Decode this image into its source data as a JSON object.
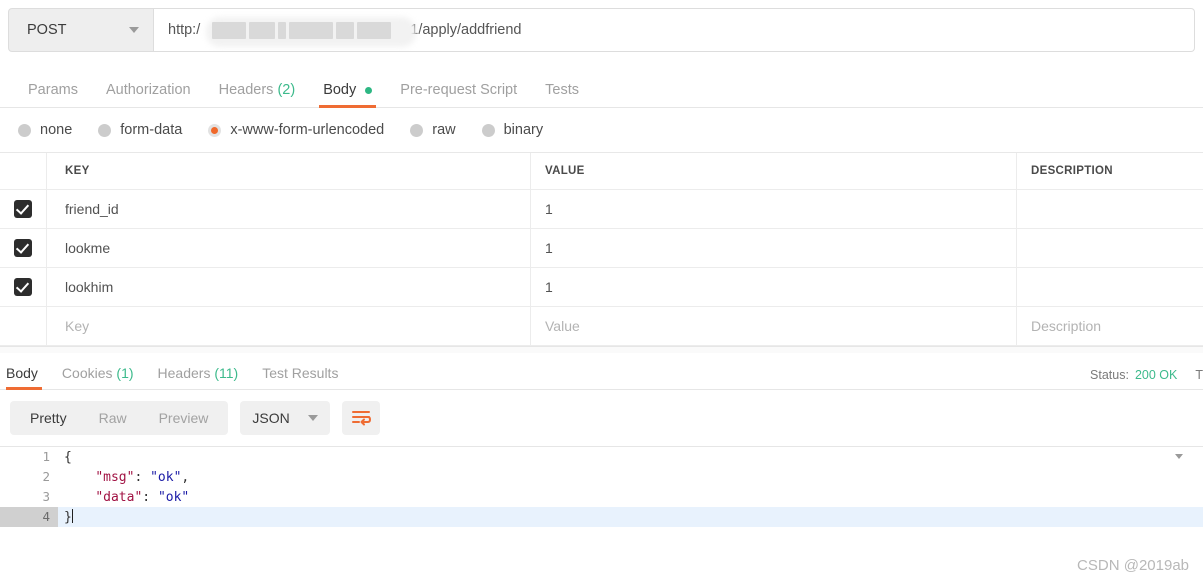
{
  "request": {
    "method": "POST",
    "method_caret": "chevron-down-icon",
    "url_prefix": "http:/",
    "url_suffix": "1/apply/addfriend",
    "url_redacted_blocks": [
      34,
      26,
      8,
      44,
      18,
      34
    ],
    "tabs": [
      {
        "label": "Params",
        "count": "",
        "active": false,
        "dot": false
      },
      {
        "label": "Authorization",
        "count": "",
        "active": false,
        "dot": false
      },
      {
        "label": "Headers",
        "count": "(2)",
        "active": false,
        "dot": false
      },
      {
        "label": "Body",
        "count": "",
        "active": true,
        "dot": true
      },
      {
        "label": "Pre-request Script",
        "count": "",
        "active": false,
        "dot": false
      },
      {
        "label": "Tests",
        "count": "",
        "active": false,
        "dot": false
      }
    ],
    "body_types": [
      {
        "label": "none",
        "selected": false
      },
      {
        "label": "form-data",
        "selected": false
      },
      {
        "label": "x-www-form-urlencoded",
        "selected": true
      },
      {
        "label": "raw",
        "selected": false
      },
      {
        "label": "binary",
        "selected": false
      }
    ],
    "table": {
      "columns": [
        "KEY",
        "VALUE",
        "DESCRIPTION"
      ],
      "rows": [
        {
          "checked": true,
          "key": "friend_id",
          "value": "1",
          "description": ""
        },
        {
          "checked": true,
          "key": "lookme",
          "value": "1",
          "description": ""
        },
        {
          "checked": true,
          "key": "lookhim",
          "value": "1",
          "description": ""
        }
      ],
      "placeholder_row": {
        "key": "Key",
        "value": "Value",
        "description": "Description"
      }
    }
  },
  "response": {
    "tabs": [
      {
        "label": "Body",
        "count": "",
        "active": true
      },
      {
        "label": "Cookies",
        "count": "(1)",
        "active": false
      },
      {
        "label": "Headers",
        "count": "(11)",
        "active": false
      },
      {
        "label": "Test Results",
        "count": "",
        "active": false
      }
    ],
    "status_label": "Status:",
    "status_value": "200 OK",
    "time_label": "T",
    "view_modes": [
      {
        "label": "Pretty",
        "active": true
      },
      {
        "label": "Raw",
        "active": false
      },
      {
        "label": "Preview",
        "active": false
      }
    ],
    "format": "JSON",
    "wrap_icon": "word-wrap-icon",
    "code": {
      "lines": [
        {
          "num": "1",
          "foldable": true,
          "active": false,
          "segments": [
            {
              "t": "{",
              "c": "jpunc"
            }
          ]
        },
        {
          "num": "2",
          "foldable": false,
          "active": false,
          "segments": [
            {
              "t": "    ",
              "c": "jpunc"
            },
            {
              "t": "\"msg\"",
              "c": "jkey"
            },
            {
              "t": ": ",
              "c": "jpunc"
            },
            {
              "t": "\"ok\"",
              "c": "jval"
            },
            {
              "t": ",",
              "c": "jpunc"
            }
          ]
        },
        {
          "num": "3",
          "foldable": false,
          "active": false,
          "segments": [
            {
              "t": "    ",
              "c": "jpunc"
            },
            {
              "t": "\"data\"",
              "c": "jkey"
            },
            {
              "t": ": ",
              "c": "jpunc"
            },
            {
              "t": "\"ok\"",
              "c": "jval"
            }
          ]
        },
        {
          "num": "4",
          "foldable": false,
          "active": true,
          "segments": [
            {
              "t": "}",
              "c": "jpunc"
            }
          ]
        }
      ]
    }
  },
  "watermark": "CSDN @2019ab",
  "colors": {
    "accent": "#ef6c33",
    "success": "#3dba8c",
    "key": "#a11243",
    "value": "#1a1aa6",
    "active_line": "#e8f2fd"
  }
}
